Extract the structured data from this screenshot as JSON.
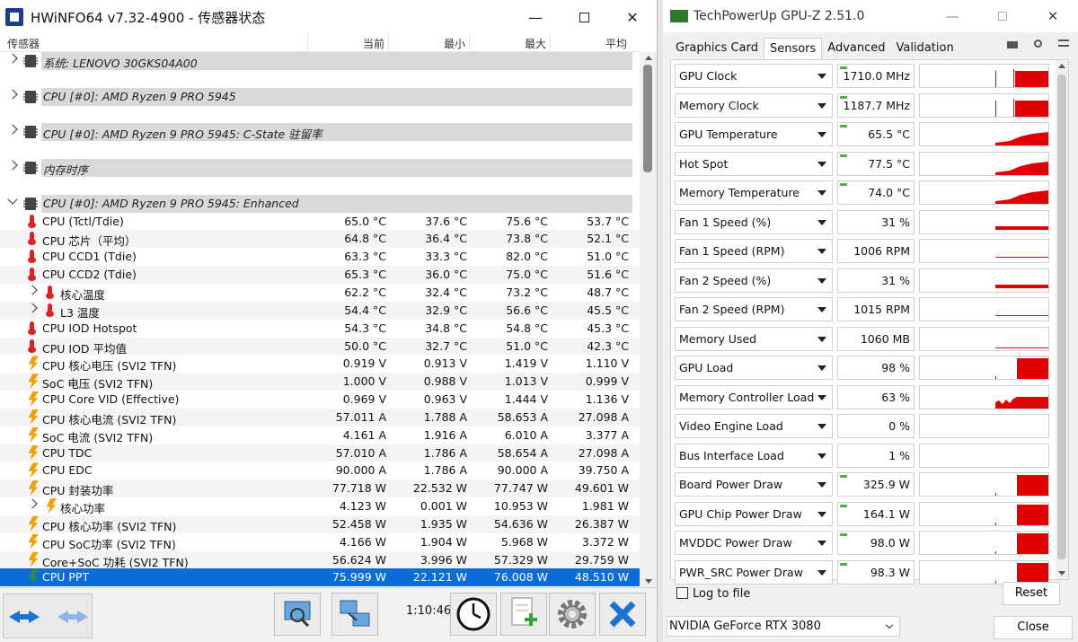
{
  "hwinfo": {
    "title": "HWiNFO64 v7.32-4900 - 传感器状态",
    "columns": {
      "sensor": "传感器",
      "current": "当前",
      "min": "最小",
      "max": "最大",
      "avg": "平均"
    },
    "rows": [
      {
        "type": "group",
        "label": "系统: LENOVO 30GKS04A00",
        "icon": "chip-icon",
        "expanded": false
      },
      {
        "type": "blank"
      },
      {
        "type": "group",
        "label": "CPU [#0]: AMD Ryzen 9 PRO 5945",
        "icon": "chip-icon",
        "expanded": false
      },
      {
        "type": "blank"
      },
      {
        "type": "group",
        "label": "CPU [#0]: AMD Ryzen 9 PRO 5945: C-State 驻留率",
        "icon": "chip-icon",
        "expanded": false
      },
      {
        "type": "blank"
      },
      {
        "type": "group",
        "label": "内存时序",
        "icon": "chip-icon",
        "expanded": false
      },
      {
        "type": "blank"
      },
      {
        "type": "group",
        "label": "CPU [#0]: AMD Ryzen 9 PRO 5945: Enhanced",
        "icon": "chip-icon",
        "expanded": true
      },
      {
        "type": "item",
        "label": "CPU (Tctl/Tdie)",
        "icon": "thermometer-icon",
        "cur": "65.0 °C",
        "min": "37.6 °C",
        "max": "75.6 °C",
        "avg": "53.7 °C"
      },
      {
        "type": "item",
        "label": "CPU 芯片（平均）",
        "icon": "thermometer-icon",
        "cur": "64.8 °C",
        "min": "36.4 °C",
        "max": "73.8 °C",
        "avg": "52.1 °C"
      },
      {
        "type": "item",
        "label": "CPU CCD1 (Tdie)",
        "icon": "thermometer-icon",
        "cur": "63.3 °C",
        "min": "33.3 °C",
        "max": "82.0 °C",
        "avg": "51.0 °C"
      },
      {
        "type": "item",
        "label": "CPU CCD2 (Tdie)",
        "icon": "thermometer-icon",
        "cur": "65.3 °C",
        "min": "36.0 °C",
        "max": "75.0 °C",
        "avg": "51.6 °C"
      },
      {
        "type": "subitem",
        "label": "核心温度",
        "icon": "thermometer-icon",
        "cur": "62.2 °C",
        "min": "32.4 °C",
        "max": "73.2 °C",
        "avg": "48.7 °C"
      },
      {
        "type": "subitem",
        "label": "L3 温度",
        "icon": "thermometer-icon",
        "cur": "54.4 °C",
        "min": "32.9 °C",
        "max": "56.6 °C",
        "avg": "45.5 °C"
      },
      {
        "type": "item",
        "label": "CPU IOD Hotspot",
        "icon": "thermometer-icon",
        "cur": "54.3 °C",
        "min": "34.8 °C",
        "max": "54.8 °C",
        "avg": "45.3 °C"
      },
      {
        "type": "item",
        "label": "CPU IOD 平均值",
        "icon": "thermometer-icon",
        "cur": "50.0 °C",
        "min": "32.7 °C",
        "max": "51.0 °C",
        "avg": "42.3 °C"
      },
      {
        "type": "item",
        "label": "CPU 核心电压 (SVI2 TFN)",
        "icon": "bolt-icon",
        "cur": "0.919 V",
        "min": "0.913 V",
        "max": "1.419 V",
        "avg": "1.110 V"
      },
      {
        "type": "item",
        "label": "SoC 电压 (SVI2 TFN)",
        "icon": "bolt-icon",
        "cur": "1.000 V",
        "min": "0.988 V",
        "max": "1.013 V",
        "avg": "0.999 V"
      },
      {
        "type": "item",
        "label": "CPU Core VID (Effective)",
        "icon": "bolt-icon",
        "cur": "0.969 V",
        "min": "0.963 V",
        "max": "1.444 V",
        "avg": "1.136 V"
      },
      {
        "type": "item",
        "label": "CPU 核心电流 (SVI2 TFN)",
        "icon": "bolt-icon",
        "cur": "57.011 A",
        "min": "1.788 A",
        "max": "58.653 A",
        "avg": "27.098 A"
      },
      {
        "type": "item",
        "label": "SoC 电流 (SVI2 TFN)",
        "icon": "bolt-icon",
        "cur": "4.161 A",
        "min": "1.916 A",
        "max": "6.010 A",
        "avg": "3.377 A"
      },
      {
        "type": "item",
        "label": "CPU TDC",
        "icon": "bolt-icon",
        "cur": "57.010 A",
        "min": "1.786 A",
        "max": "58.654 A",
        "avg": "27.098 A"
      },
      {
        "type": "item",
        "label": "CPU EDC",
        "icon": "bolt-icon",
        "cur": "90.000 A",
        "min": "1.786 A",
        "max": "90.000 A",
        "avg": "39.750 A"
      },
      {
        "type": "item",
        "label": "CPU 封装功率",
        "icon": "bolt-icon",
        "cur": "77.718 W",
        "min": "22.532 W",
        "max": "77.747 W",
        "avg": "49.601 W"
      },
      {
        "type": "subitem",
        "label": "核心功率",
        "icon": "bolt-icon",
        "cur": "4.123 W",
        "min": "0.001 W",
        "max": "10.953 W",
        "avg": "1.981 W"
      },
      {
        "type": "item",
        "label": "CPU 核心功率 (SVI2 TFN)",
        "icon": "bolt-icon",
        "cur": "52.458 W",
        "min": "1.935 W",
        "max": "54.636 W",
        "avg": "26.387 W"
      },
      {
        "type": "item",
        "label": "CPU SoC功率 (SVI2 TFN)",
        "icon": "bolt-icon",
        "cur": "4.166 W",
        "min": "1.904 W",
        "max": "5.968 W",
        "avg": "3.372 W"
      },
      {
        "type": "item",
        "label": "Core+SoC 功耗 (SVI2 TFN)",
        "icon": "bolt-icon",
        "cur": "56.624 W",
        "min": "3.996 W",
        "max": "57.329 W",
        "avg": "29.759 W"
      },
      {
        "type": "item",
        "label": "CPU PPT",
        "icon": "bolt-green-icon",
        "cur": "75.999 W",
        "min": "22.121 W",
        "max": "76.008 W",
        "avg": "48.510 W",
        "selected": true
      }
    ],
    "footer": {
      "timer": "1:10:46"
    }
  },
  "gpuz": {
    "title": "TechPowerUp GPU-Z 2.51.0",
    "tabs": [
      "Graphics Card",
      "Sensors",
      "Advanced",
      "Validation"
    ],
    "active_tab": "Sensors",
    "sensors": [
      {
        "name": "GPU Clock",
        "value": "1710.0 MHz",
        "marker": true,
        "graph": "spike"
      },
      {
        "name": "Memory Clock",
        "value": "1187.7 MHz",
        "marker": true,
        "graph": "spike"
      },
      {
        "name": "GPU Temperature",
        "value": "65.5 °C",
        "marker": true,
        "graph": "ramp"
      },
      {
        "name": "Hot Spot",
        "value": "77.5 °C",
        "marker": true,
        "graph": "ramp"
      },
      {
        "name": "Memory Temperature",
        "value": "74.0 °C",
        "marker": true,
        "graph": "ramp"
      },
      {
        "name": "Fan 1 Speed (%)",
        "value": "31 %",
        "marker": false,
        "graph": "flat-high"
      },
      {
        "name": "Fan 1 Speed (RPM)",
        "value": "1006 RPM",
        "marker": false,
        "graph": "line"
      },
      {
        "name": "Fan 2 Speed (%)",
        "value": "31 %",
        "marker": false,
        "graph": "flat-high"
      },
      {
        "name": "Fan 2 Speed (RPM)",
        "value": "1015 RPM",
        "marker": false,
        "graph": "line"
      },
      {
        "name": "Memory Used",
        "value": "1060 MB",
        "marker": false,
        "graph": "line-low"
      },
      {
        "name": "GPU Load",
        "value": "98 %",
        "marker": false,
        "graph": "block"
      },
      {
        "name": "Memory Controller Load",
        "value": "63 %",
        "marker": false,
        "graph": "noisy"
      },
      {
        "name": "Video Engine Load",
        "value": "0 %",
        "marker": false,
        "graph": "none"
      },
      {
        "name": "Bus Interface Load",
        "value": "1 %",
        "marker": false,
        "graph": "none"
      },
      {
        "name": "Board Power Draw",
        "value": "325.9 W",
        "marker": true,
        "graph": "block"
      },
      {
        "name": "GPU Chip Power Draw",
        "value": "164.1 W",
        "marker": true,
        "graph": "block"
      },
      {
        "name": "MVDDC Power Draw",
        "value": "98.0 W",
        "marker": true,
        "graph": "block"
      },
      {
        "name": "PWR_SRC Power Draw",
        "value": "98.3 W",
        "marker": true,
        "graph": "block"
      }
    ],
    "log_label": "Log to file",
    "reset_label": "Reset",
    "gpu_name": "NVIDIA GeForce RTX 3080",
    "close_label": "Close",
    "graph_color": "#e00000"
  }
}
